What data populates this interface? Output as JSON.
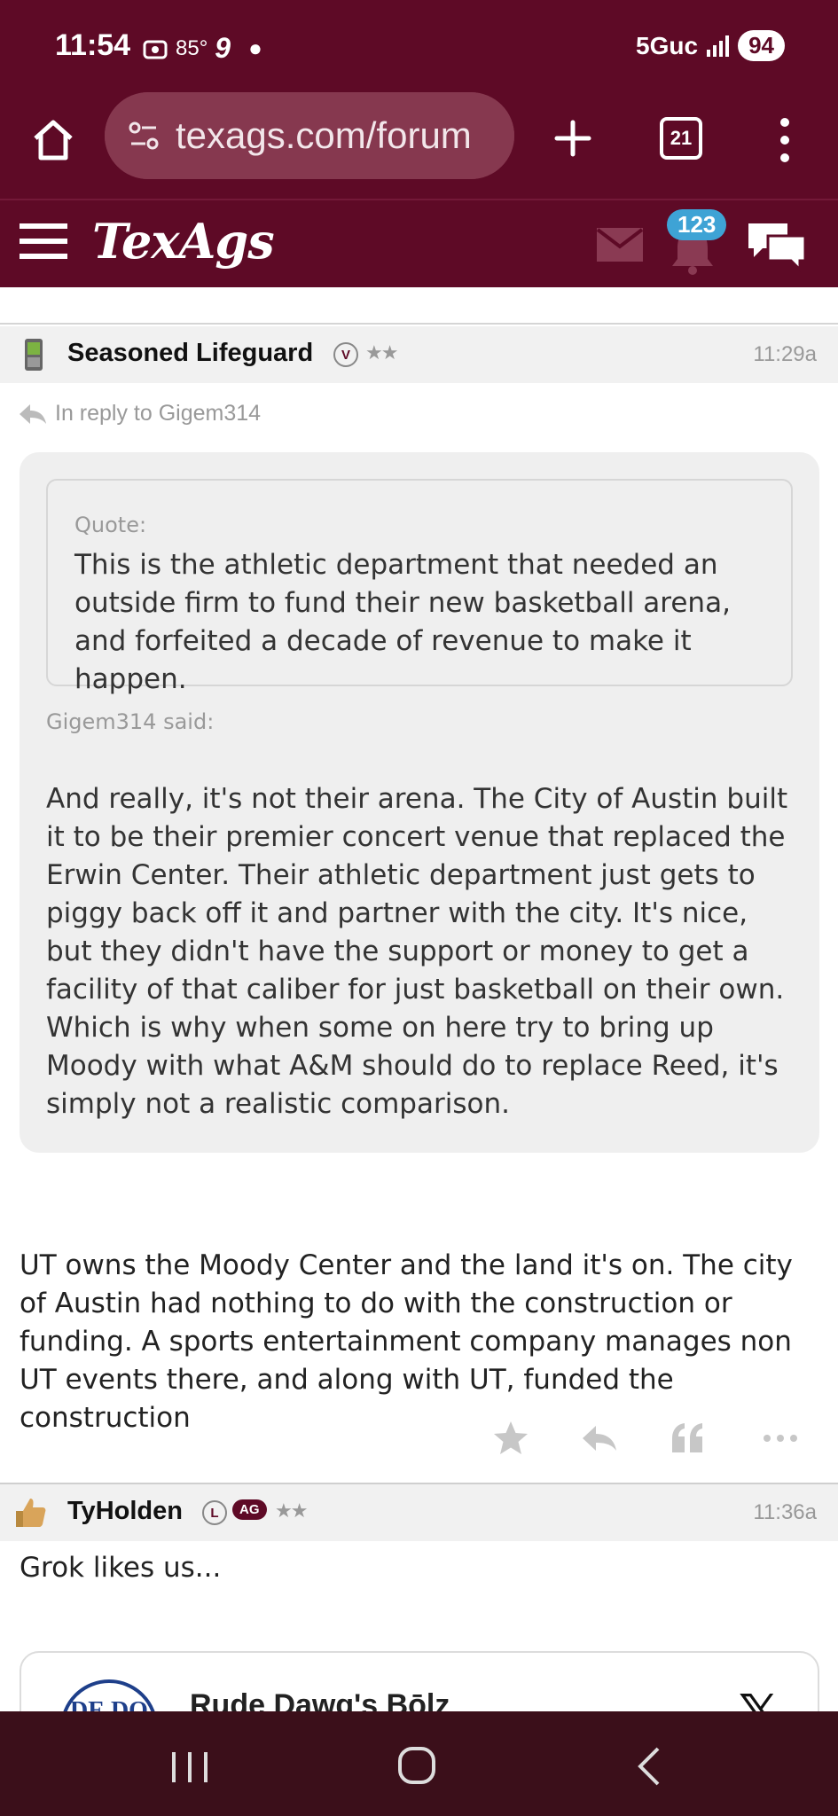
{
  "status_bar": {
    "time": "11:54",
    "temp": "85°",
    "notif_num": "9",
    "network": "5Guc",
    "battery": "94"
  },
  "browser": {
    "url": "texags.com/forum",
    "tab_count": "21"
  },
  "site_header": {
    "logo": "TexAgs",
    "notification_count": "123"
  },
  "post1": {
    "author": "Seasoned Lifeguard",
    "badge": "V",
    "stars": "★★",
    "time": "11:29a",
    "reply_to": "In reply to Gigem314",
    "quote_label": "Quote:",
    "inner_quote": "This is the athletic department that needed an outside firm to fund their new basketball arena, and forfeited a decade of revenue to make it happen.",
    "said_by": "Gigem314 said:",
    "outer_quote": "And really, it's not their arena. The City of Austin built it to be their premier concert venue that replaced the Erwin Center. Their athletic department just gets to piggy back off it and partner with the city. It's nice, but they didn't have the support or money to get a facility of that caliber for just basketball on their own. Which is why when some on here try to bring up Moody with what A&M should do to replace Reed, it's simply not a realistic comparison.",
    "body": "UT owns the Moody Center and the land it's on. The city of Austin had nothing to do with the construction or funding. A sports entertainment company manages non UT events there, and along with UT, funded the construction"
  },
  "post2": {
    "author": "TyHolden",
    "badge_l": "L",
    "badge_ag": "AG",
    "stars": "★★",
    "time": "11:36a",
    "body": "Grok likes us...",
    "embed_name": "Rude Dawg's Bōlz",
    "embed_logo_text": "DE DO"
  },
  "colors": {
    "maroon": "#5e0a26",
    "url_pill": "#86384f",
    "badge_blue": "#3ea3d5",
    "nav_bar": "#3b0f1a"
  },
  "icons": [
    "home-icon",
    "site-settings-icon",
    "plus-icon",
    "tabs-icon",
    "more-vert-icon",
    "hamburger-icon",
    "mail-icon",
    "bell-icon",
    "chat-icon",
    "reply-icon",
    "star-icon",
    "quote-icon",
    "more-horiz-icon",
    "recent-apps-icon",
    "home-circle-icon",
    "back-icon",
    "x-logo-icon"
  ]
}
